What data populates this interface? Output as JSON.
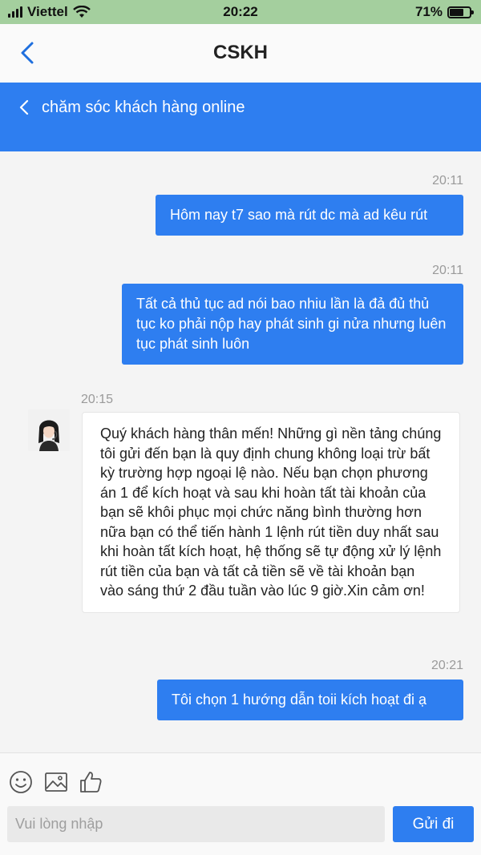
{
  "status_bar": {
    "carrier": "Viettel",
    "time": "20:22",
    "battery": "71%",
    "battery_level": 0.71
  },
  "nav": {
    "title": "CSKH"
  },
  "chat_header": {
    "title": "chăm sóc khách hàng online"
  },
  "messages": [
    {
      "time": "20:11",
      "text": "Hôm nay t7 sao mà rút dc mà ad kêu rút"
    },
    {
      "time": "20:11",
      "text": "Tất cả thủ tục ad nói bao nhiu lần là đả đủ thủ tục ko phải nộp hay phát sinh gi nửa nhưng luên tục phát sinh luôn"
    },
    {
      "time": "20:15",
      "text": "Quý khách hàng thân mến! Những gì nền tảng chúng tôi gửi đến bạn là quy định chung không loại trừ bất kỳ trường hợp ngoại lệ nào. Nếu bạn chọn phương án 1 để kích hoạt và sau khi hoàn tất tài khoản của bạn sẽ khôi phục mọi chức năng bình thường hơn nữa bạn có thể tiến hành 1 lệnh rút tiền duy nhất sau khi hoàn tất kích hoạt, hệ thống sẽ tự động xử lý lệnh rút tiền của bạn và tất cả tiền sẽ về tài khoản bạn vào sáng thứ 2 đầu tuần vào lúc 9 giờ.Xin cảm ơn!"
    },
    {
      "time": "20:21",
      "text": "Tôi chọn 1 hướng dẫn toii kích hoạt đi ạ"
    }
  ],
  "composer": {
    "placeholder": "Vui lòng nhập",
    "value": "",
    "send_label": "Gửi đi"
  },
  "colors": {
    "accent": "#2e7ef0",
    "status_bar": "#a4cf9e"
  },
  "icons": [
    "back-chevron-icon",
    "emoji-icon",
    "image-icon",
    "thumbs-up-icon"
  ]
}
